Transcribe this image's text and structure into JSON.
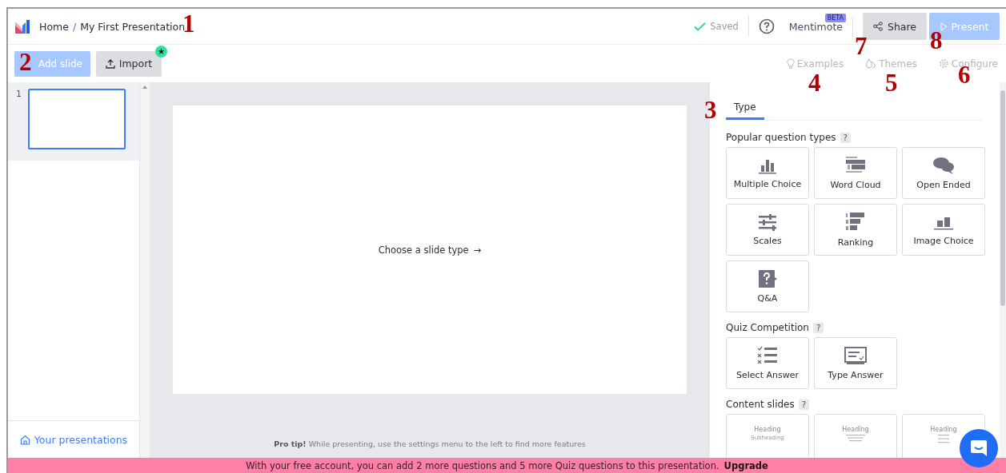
{
  "topbar": {
    "breadcrumb": [
      {
        "label": "Home"
      },
      {
        "label": "My First Presentation"
      }
    ],
    "separator": "/",
    "saved": "Saved",
    "mentimote": "Mentimote",
    "beta": "BETA",
    "share": "Share",
    "present": "Present"
  },
  "toolbar": {
    "add_slide": "Add slide",
    "import": "Import",
    "links": [
      {
        "kind": "examples",
        "label": "Examples"
      },
      {
        "kind": "themes",
        "label": "Themes"
      },
      {
        "kind": "configure",
        "label": "Configure"
      }
    ]
  },
  "slides": [
    {
      "number": "1",
      "selected": true
    }
  ],
  "your_presentations": "Your presentations",
  "canvas": {
    "prompt": "Choose a slide type",
    "arrow": "→"
  },
  "pro_tip": "**Pro tip!** While presenting, use the settings menu to the left to find more features",
  "panel": {
    "tabs": [
      {
        "label": "Type",
        "selected": true
      }
    ],
    "sections": [
      {
        "title": "Popular question types",
        "help": "?",
        "types": [
          {
            "kind": "bars",
            "label": "Multiple Choice"
          },
          {
            "kind": "wordcloud",
            "label": "Word Cloud"
          },
          {
            "kind": "bubbles",
            "label": "Open Ended"
          },
          {
            "kind": "scales",
            "label": "Scales"
          },
          {
            "kind": "ranking",
            "label": "Ranking"
          },
          {
            "kind": "images",
            "label": "Image Choice"
          },
          {
            "kind": "qa",
            "label": "Q&A"
          }
        ]
      },
      {
        "title": "Quiz Competition",
        "help": "?",
        "types": [
          {
            "kind": "select",
            "label": "Select Answer"
          },
          {
            "kind": "typeanswer",
            "label": "Type Answer"
          }
        ]
      },
      {
        "title": "Content slides",
        "help": "?",
        "types": [
          {
            "kind": "heading",
            "heading": "Heading",
            "subheading": "Subheading"
          },
          {
            "kind": "paragraph",
            "heading": "Heading"
          },
          {
            "kind": "bullets",
            "heading": "Heading"
          }
        ]
      }
    ]
  },
  "banner": {
    "text": "With your free account, you can add 2 more questions and 5 more Quiz questions to this presentation.",
    "link": "Upgrade"
  },
  "callouts": [
    {
      "number": "1"
    },
    {
      "number": "2"
    },
    {
      "number": "3"
    },
    {
      "number": "4"
    },
    {
      "number": "5"
    },
    {
      "number": "6"
    },
    {
      "number": "7"
    },
    {
      "number": "8"
    }
  ]
}
